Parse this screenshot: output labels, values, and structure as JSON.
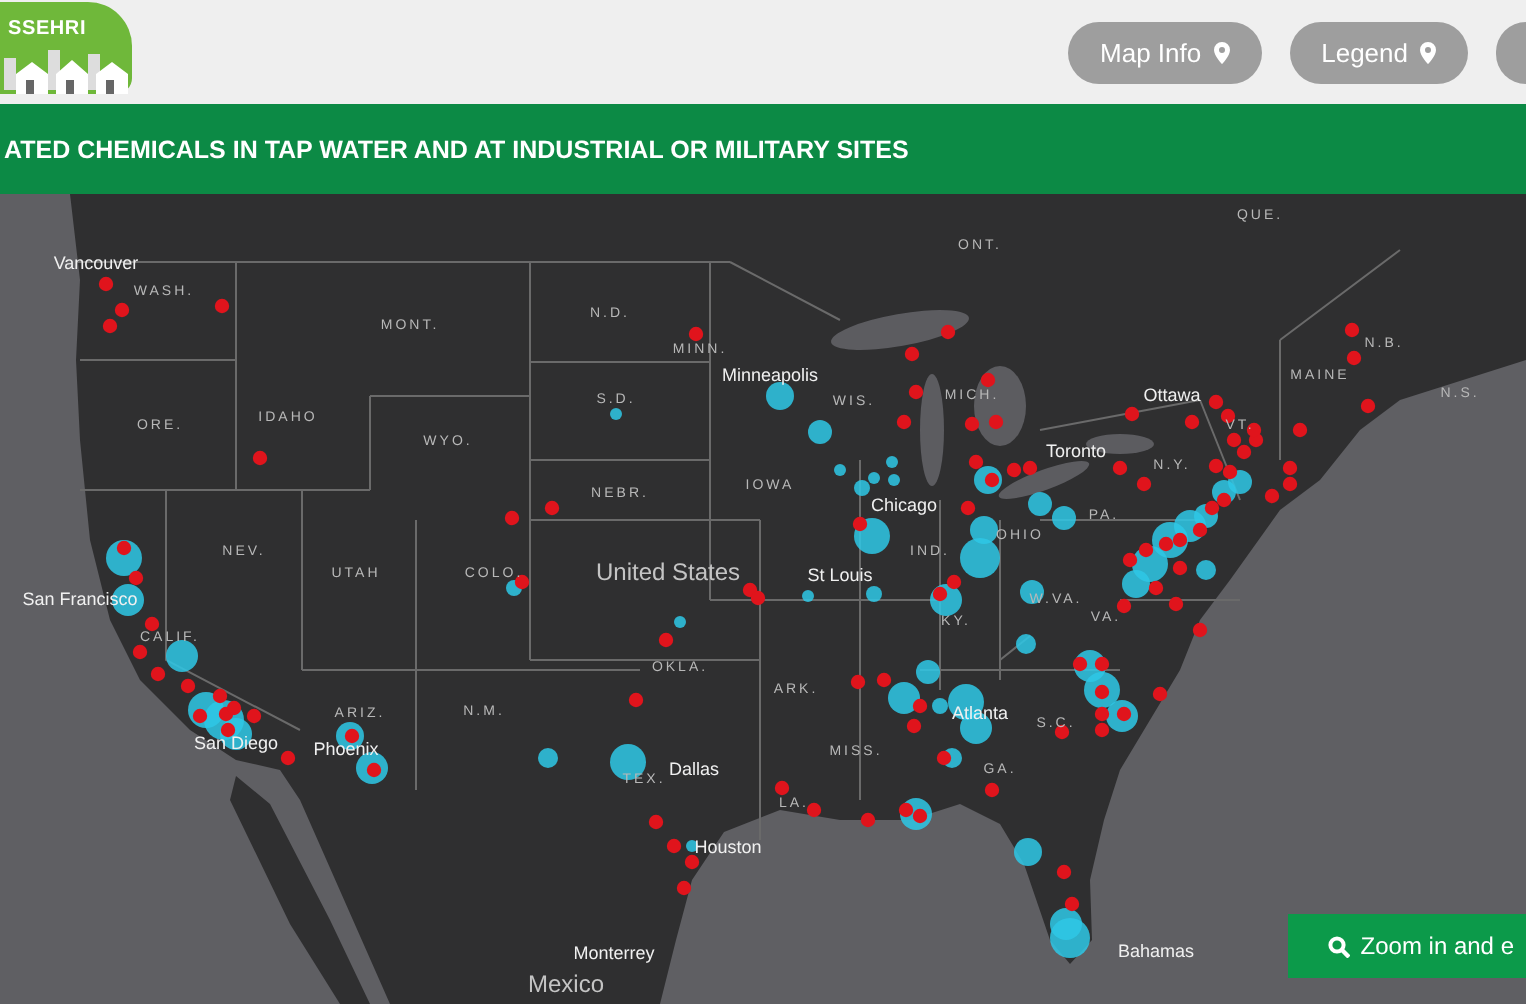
{
  "header": {
    "logo_text": "SSEHRI",
    "buttons": [
      {
        "label": "Map Info"
      },
      {
        "label": "Legend"
      }
    ]
  },
  "banner": {
    "title": "ATED CHEMICALS IN TAP WATER AND AT INDUSTRIAL OR MILITARY SITES"
  },
  "map": {
    "labels": [
      {
        "text": "QUE.",
        "kind": "state"
      },
      {
        "text": "ONT.",
        "kind": "state"
      },
      {
        "text": "Vancouver",
        "kind": "city"
      },
      {
        "text": "WASH.",
        "kind": "state"
      },
      {
        "text": "MONT.",
        "kind": "state"
      },
      {
        "text": "N.D.",
        "kind": "state"
      },
      {
        "text": "MINN.",
        "kind": "state"
      },
      {
        "text": "N.B.",
        "kind": "state"
      },
      {
        "text": "Minneapolis",
        "kind": "city"
      },
      {
        "text": "MAINE",
        "kind": "state"
      },
      {
        "text": "S.D.",
        "kind": "state"
      },
      {
        "text": "WIS.",
        "kind": "state"
      },
      {
        "text": "MICH.",
        "kind": "state"
      },
      {
        "text": "Ottawa",
        "kind": "city"
      },
      {
        "text": "N.S.",
        "kind": "state"
      },
      {
        "text": "ORE.",
        "kind": "state"
      },
      {
        "text": "IDAHO",
        "kind": "state"
      },
      {
        "text": "VT.",
        "kind": "state"
      },
      {
        "text": "WYO.",
        "kind": "state"
      },
      {
        "text": "Toronto",
        "kind": "city"
      },
      {
        "text": "N.Y.",
        "kind": "state"
      },
      {
        "text": "NEBR.",
        "kind": "state"
      },
      {
        "text": "IOWA",
        "kind": "state"
      },
      {
        "text": "Chicago",
        "kind": "city"
      },
      {
        "text": "PA.",
        "kind": "state"
      },
      {
        "text": "OHIO",
        "kind": "state"
      },
      {
        "text": "NEV.",
        "kind": "state"
      },
      {
        "text": "IND.",
        "kind": "state"
      },
      {
        "text": "UTAH",
        "kind": "state"
      },
      {
        "text": "COLO.",
        "kind": "state"
      },
      {
        "text": "United States",
        "kind": "country"
      },
      {
        "text": "St Louis",
        "kind": "city"
      },
      {
        "text": "San Francisco",
        "kind": "city"
      },
      {
        "text": "W.VA.",
        "kind": "state"
      },
      {
        "text": "KY.",
        "kind": "state"
      },
      {
        "text": "VA.",
        "kind": "state"
      },
      {
        "text": "CALIF.",
        "kind": "state"
      },
      {
        "text": "OKLA.",
        "kind": "state"
      },
      {
        "text": "ARK.",
        "kind": "state"
      },
      {
        "text": "ARIZ.",
        "kind": "state"
      },
      {
        "text": "N.M.",
        "kind": "state"
      },
      {
        "text": "Atlanta",
        "kind": "city"
      },
      {
        "text": "S.C.",
        "kind": "state"
      },
      {
        "text": "San Diego",
        "kind": "city"
      },
      {
        "text": "Phoenix",
        "kind": "city"
      },
      {
        "text": "MISS.",
        "kind": "state"
      },
      {
        "text": "TEX.",
        "kind": "state"
      },
      {
        "text": "Dallas",
        "kind": "city"
      },
      {
        "text": "GA.",
        "kind": "state"
      },
      {
        "text": "LA.",
        "kind": "state"
      },
      {
        "text": "Houston",
        "kind": "city"
      },
      {
        "text": "Monterrey",
        "kind": "city"
      },
      {
        "text": "Bahamas",
        "kind": "city"
      },
      {
        "text": "Mexico",
        "kind": "country"
      }
    ]
  },
  "zoom_button": {
    "label": "Zoom in and e"
  }
}
